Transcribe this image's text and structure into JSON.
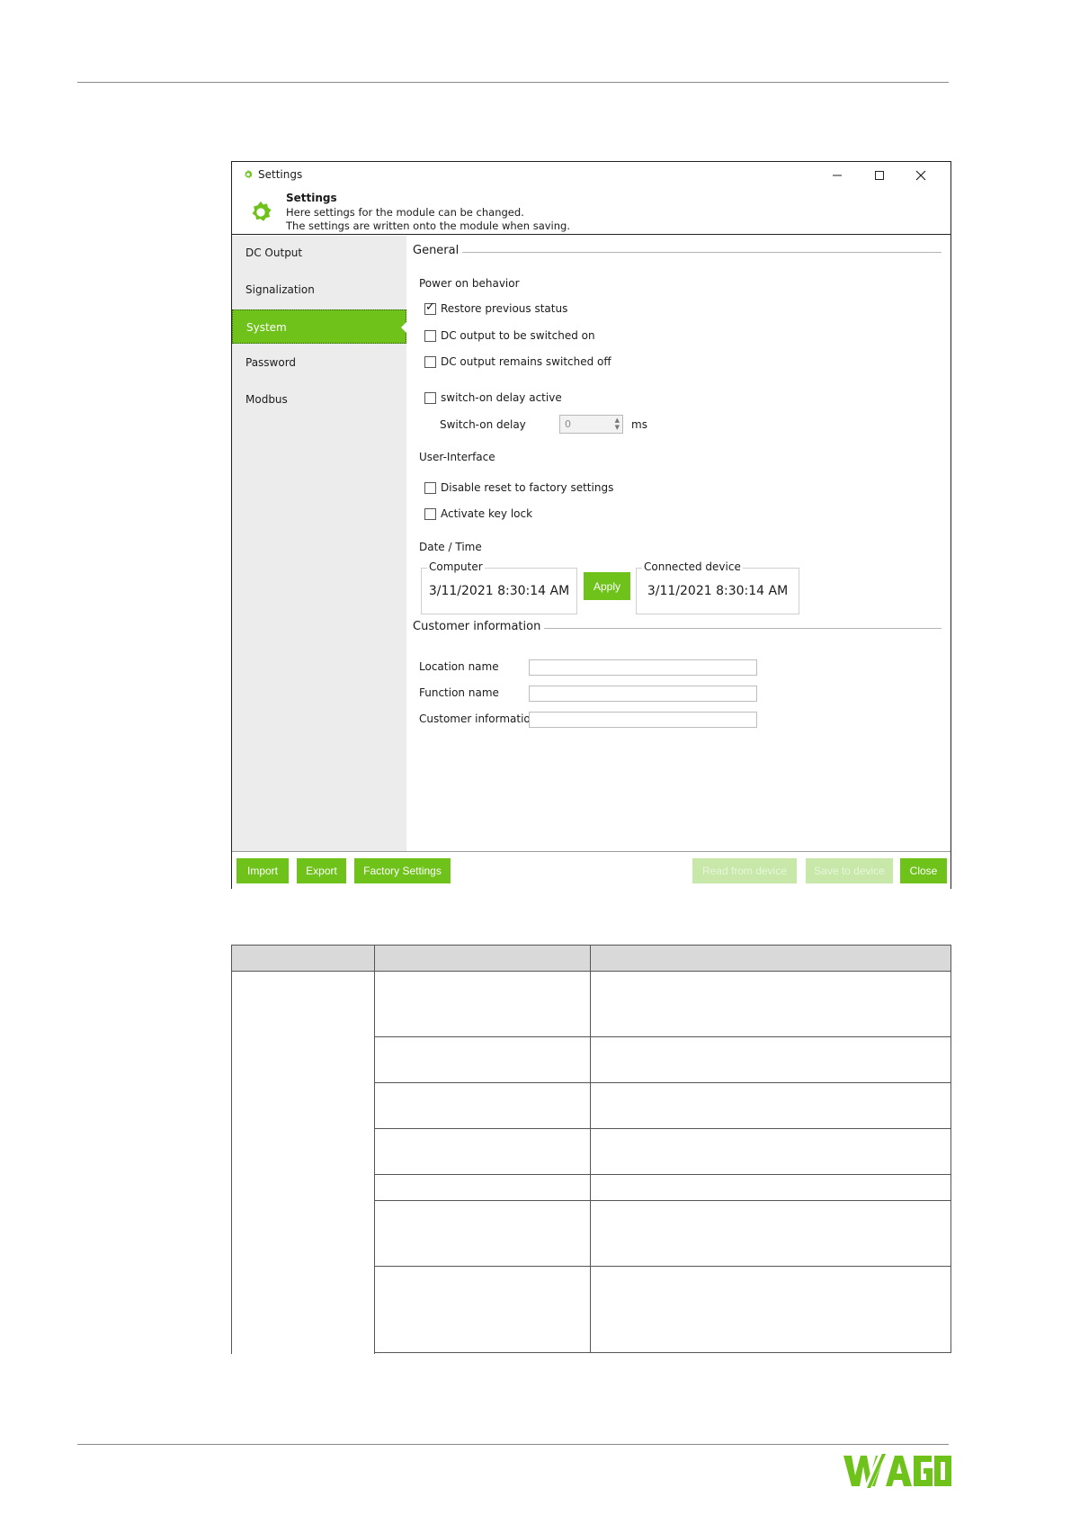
{
  "window": {
    "title": "Settings",
    "header": {
      "title": "Settings",
      "line1": "Here settings for the module can be changed.",
      "line2": "The settings are written onto the module when saving."
    }
  },
  "sidebar": {
    "items": [
      {
        "label": "DC Output"
      },
      {
        "label": "Signalization"
      },
      {
        "label": "System",
        "active": true
      },
      {
        "label": "Password"
      },
      {
        "label": "Modbus"
      }
    ]
  },
  "general": {
    "title": "General",
    "power_on": {
      "label": "Power on behavior",
      "options": [
        {
          "label": "Restore previous status",
          "checked": true
        },
        {
          "label": "DC output to be switched on",
          "checked": false
        },
        {
          "label": "DC output remains switched off",
          "checked": false
        }
      ]
    },
    "switch_on_delay_active": {
      "label": "switch-on delay active",
      "checked": false
    },
    "switch_on_delay": {
      "label": "Switch-on delay",
      "value": "0",
      "unit": "ms"
    },
    "user_interface": {
      "label": "User-Interface",
      "options": [
        {
          "label": "Disable reset to factory settings",
          "checked": false
        },
        {
          "label": "Activate key lock",
          "checked": false
        }
      ]
    },
    "date_time": {
      "label": "Date / Time",
      "computer": {
        "title": "Computer",
        "value": "3/11/2021 8:30:14 AM"
      },
      "apply_label": "Apply",
      "device": {
        "title": "Connected device",
        "value": "3/11/2021 8:30:14 AM"
      }
    }
  },
  "customer": {
    "title": "Customer information",
    "fields": [
      {
        "label": "Location name",
        "value": ""
      },
      {
        "label": "Function name",
        "value": ""
      },
      {
        "label": "Customer information",
        "value": ""
      }
    ]
  },
  "footer": {
    "import_label": "Import",
    "export_label": "Export",
    "factory_label": "Factory Settings",
    "read_label": "Read from device",
    "save_label": "Save to device",
    "close_label": "Close"
  },
  "colors": {
    "accent": "#6ec21a",
    "accent_disabled": "#c7e8a8",
    "sidebar_bg": "#ececec",
    "table_header": "#d9d9d9"
  }
}
